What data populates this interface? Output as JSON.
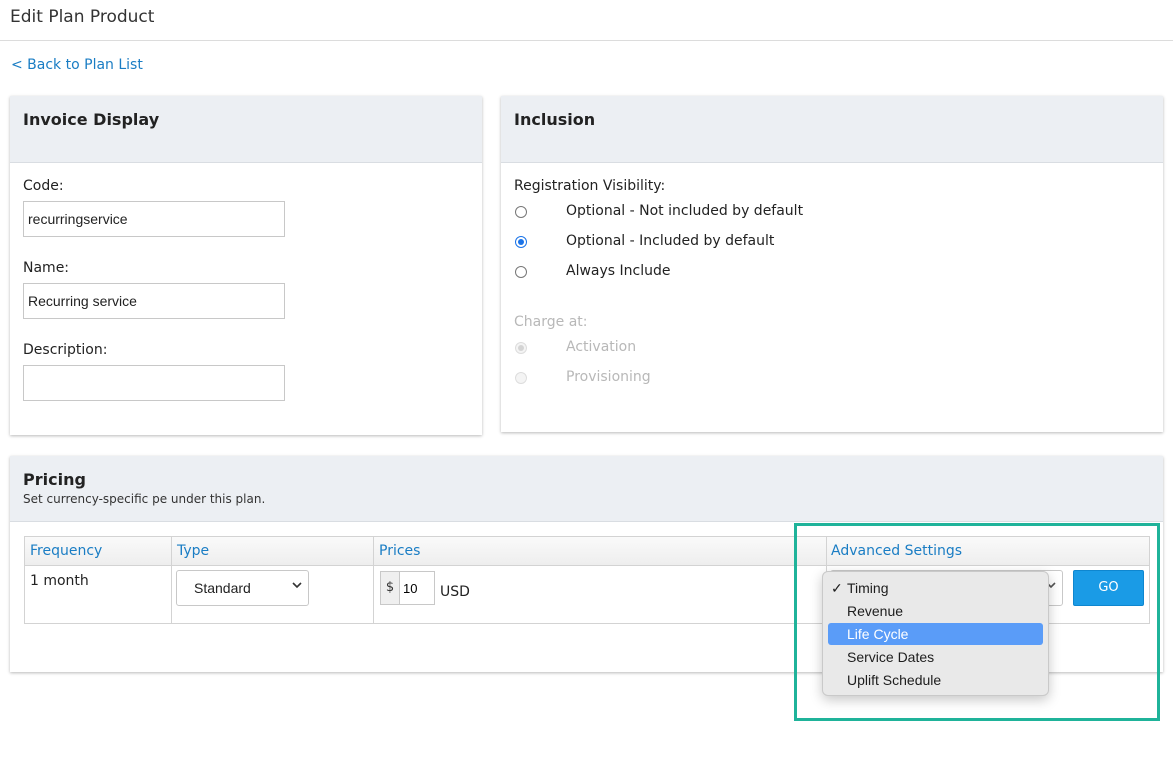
{
  "page": {
    "title": "Edit Plan Product",
    "back_link": "< Back to Plan List"
  },
  "invoice_display": {
    "title": "Invoice Display",
    "code_label": "Code:",
    "code_value": "recurringservice",
    "name_label": "Name:",
    "name_value": "Recurring service",
    "description_label": "Description:",
    "description_value": ""
  },
  "inclusion": {
    "title": "Inclusion",
    "visibility_label": "Registration Visibility:",
    "visibility_options": [
      {
        "label": "Optional - Not included by default",
        "checked": false
      },
      {
        "label": "Optional - Included by default",
        "checked": true
      },
      {
        "label": "Always Include",
        "checked": false
      }
    ],
    "charge_label": "Charge at:",
    "charge_options": [
      {
        "label": "Activation",
        "checked": true
      },
      {
        "label": "Provisioning",
        "checked": false
      }
    ]
  },
  "pricing": {
    "title": "Pricing",
    "subtitle": "Set currency-specific pe under this plan.",
    "columns": [
      "Frequency",
      "Type",
      "Prices",
      "Advanced Settings"
    ],
    "row": {
      "frequency": "1 month",
      "type": "Standard",
      "currency_symbol": "$",
      "price": "10",
      "currency": "USD"
    },
    "go_label": "GO",
    "advanced_options": [
      {
        "label": "Timing",
        "selected": true,
        "highlighted": false
      },
      {
        "label": "Revenue",
        "selected": false,
        "highlighted": false
      },
      {
        "label": "Life Cycle",
        "selected": false,
        "highlighted": true
      },
      {
        "label": "Service Dates",
        "selected": false,
        "highlighted": false
      },
      {
        "label": "Uplift Schedule",
        "selected": false,
        "highlighted": false
      }
    ],
    "selected_check": "✓"
  },
  "colors": {
    "link": "#1a7dc4",
    "go_button": "#1a9be6",
    "highlight_border": "#1fb39a",
    "dropdown_active": "#5a9cf8",
    "radio_checked": "#1a73e8"
  }
}
